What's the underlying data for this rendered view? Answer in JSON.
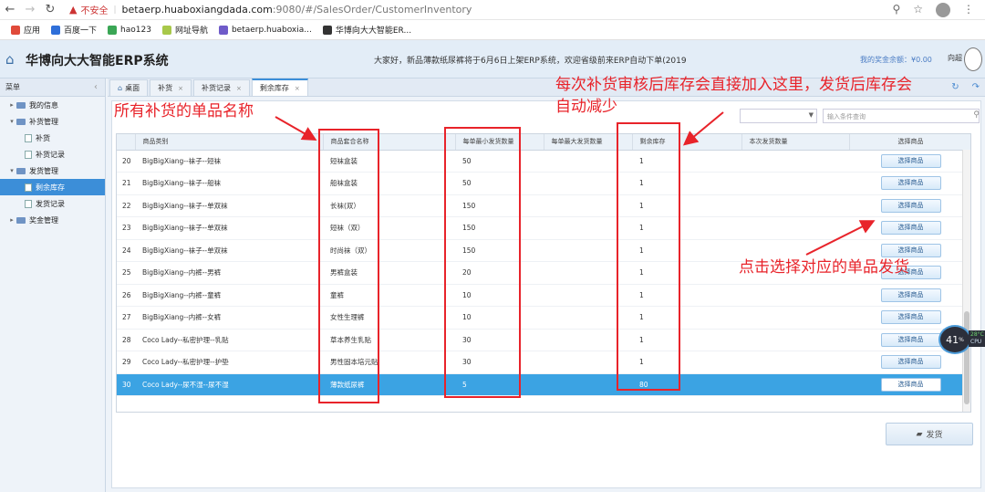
{
  "browser": {
    "security_label": "不安全",
    "url_host": "betaerp.huaboxiangdada.com",
    "url_rest": ":9080/#/SalesOrder/CustomerInventory"
  },
  "bookmarks": [
    {
      "label": "应用",
      "color": "#e04a3a"
    },
    {
      "label": "百度一下",
      "color": "#2f6fd9"
    },
    {
      "label": "hao123",
      "color": "#3aa655"
    },
    {
      "label": "网址导航",
      "color": "#a8c84a"
    },
    {
      "label": "betaerp.huaboxia...",
      "color": "#6f5bc9"
    },
    {
      "label": "华博向大大智能ER...",
      "color": "#333333"
    }
  ],
  "app": {
    "title": "华博向大大智能ERP系统",
    "announcement": "大家好，新品薄款纸尿裤将于6月6日上架ERP系统，欢迎省级前来ERP自动下单(2019",
    "balance": "我的奖金余额：¥0.00",
    "user": "向超"
  },
  "sidebar": {
    "header": "菜单",
    "items": [
      {
        "label": "我的信息",
        "level": 1,
        "folder": true
      },
      {
        "label": "补货管理",
        "level": 1,
        "folder": true,
        "open": true
      },
      {
        "label": "补货",
        "level": 2
      },
      {
        "label": "补货记录",
        "level": 2
      },
      {
        "label": "发货管理",
        "level": 1,
        "folder": true,
        "open": true
      },
      {
        "label": "剩余库存",
        "level": 2,
        "active": true
      },
      {
        "label": "发货记录",
        "level": 2
      },
      {
        "label": "奖金管理",
        "level": 1,
        "folder": true
      }
    ]
  },
  "tabs": [
    {
      "label": "桌面",
      "active": false,
      "closable": false
    },
    {
      "label": "补货",
      "active": false,
      "closable": true
    },
    {
      "label": "补货记录",
      "active": false,
      "closable": true
    },
    {
      "label": "剩余库存",
      "active": true,
      "closable": true
    }
  ],
  "search": {
    "placeholder": "输入条件查询"
  },
  "table": {
    "columns": [
      "商品类别",
      "商品套合名称",
      "每单最小发货数量",
      "每单最大发货数量",
      "剩余库存",
      "本次发货数量",
      "选择商品"
    ],
    "rows": [
      {
        "no": "20",
        "category": "BigBigXiang--袜子--短袜",
        "name": "短袜盒装",
        "min": "50",
        "max": "",
        "stock": "1",
        "qty": "",
        "action": "选择商品"
      },
      {
        "no": "21",
        "category": "BigBigXiang--袜子--船袜",
        "name": "船袜盒装",
        "min": "50",
        "max": "",
        "stock": "1",
        "qty": "",
        "action": "选择商品"
      },
      {
        "no": "22",
        "category": "BigBigXiang--袜子--单双袜",
        "name": "长袜(双）",
        "min": "150",
        "max": "",
        "stock": "1",
        "qty": "",
        "action": "选择商品"
      },
      {
        "no": "23",
        "category": "BigBigXiang--袜子--单双袜",
        "name": "短袜（双）",
        "min": "150",
        "max": "",
        "stock": "1",
        "qty": "",
        "action": "选择商品"
      },
      {
        "no": "24",
        "category": "BigBigXiang--袜子--单双袜",
        "name": "时尚袜（双）",
        "min": "150",
        "max": "",
        "stock": "1",
        "qty": "",
        "action": "选择商品"
      },
      {
        "no": "25",
        "category": "BigBigXiang--内裤--男裤",
        "name": "男裤盒装",
        "min": "20",
        "max": "",
        "stock": "1",
        "qty": "",
        "action": "选择商品"
      },
      {
        "no": "26",
        "category": "BigBigXiang--内裤--童裤",
        "name": "童裤",
        "min": "10",
        "max": "",
        "stock": "1",
        "qty": "",
        "action": "选择商品"
      },
      {
        "no": "27",
        "category": "BigBigXiang--内裤--女裤",
        "name": "女性生理裤",
        "min": "10",
        "max": "",
        "stock": "1",
        "qty": "",
        "action": "选择商品"
      },
      {
        "no": "28",
        "category": "Coco Lady--私密护理--乳贴",
        "name": "草本养生乳贴",
        "min": "30",
        "max": "",
        "stock": "1",
        "qty": "",
        "action": "选择商品"
      },
      {
        "no": "29",
        "category": "Coco Lady--私密护理--护垫",
        "name": "男性固本培元贴",
        "min": "30",
        "max": "",
        "stock": "1",
        "qty": "",
        "action": "选择商品"
      },
      {
        "no": "30",
        "category": "Coco Lady--尿不湿--尿不湿",
        "name": "薄款纸尿裤",
        "min": "5",
        "max": "",
        "stock": "80",
        "qty": "",
        "action": "选择商品",
        "selected": true
      }
    ]
  },
  "ship_button": "发货",
  "cpu": {
    "percent": "41",
    "unit": "%",
    "temp": "28°C",
    "label": "CPU"
  },
  "annotations": {
    "product_names": "所有补货的单品名称",
    "stock_line1": "每次补货审核后库存会直接加入这里，发货后库存会",
    "stock_line2": "自动减少",
    "pick_tip": "点击选择对应的单品发货"
  }
}
